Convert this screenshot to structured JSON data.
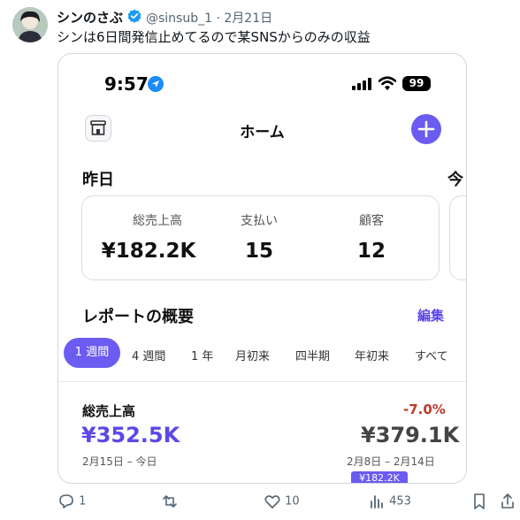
{
  "tweet": {
    "display_name": "シンのさぶ",
    "handle": "@sinsub_1",
    "separator": "·",
    "date": "2月21日",
    "text": "シンは6日間発信止めてるので某SNSからのみの収益"
  },
  "status_bar": {
    "time": "9:57",
    "battery": "99"
  },
  "app": {
    "title": "ホーム",
    "section_yesterday": "昨日",
    "section_today_partial": "今",
    "metrics": [
      {
        "label": "総売上高",
        "value": "¥182.2K"
      },
      {
        "label": "支払い",
        "value": "15"
      },
      {
        "label": "顧客",
        "value": "12"
      }
    ],
    "report": {
      "title": "レポートの概要",
      "edit_label": "編集",
      "tabs": [
        "1 週間",
        "4 週間",
        "1 年",
        "月初来",
        "四半期",
        "年初来",
        "すべて"
      ],
      "active_tab": "1 週間"
    },
    "sales": {
      "label": "総売上高",
      "change": "-7.0%",
      "current_value": "¥352.5K",
      "previous_value": "¥379.1K",
      "current_range": "2月15日 – 今日",
      "previous_range": "2月8日 – 2月14日",
      "tooltip": "¥182.2K"
    }
  },
  "actions": {
    "replies": "1",
    "reposts": "",
    "likes": "10",
    "views": "453"
  },
  "colors": {
    "accent": "#6a5cf0",
    "negative": "#c0392b",
    "verified": "#1d9bf0"
  }
}
